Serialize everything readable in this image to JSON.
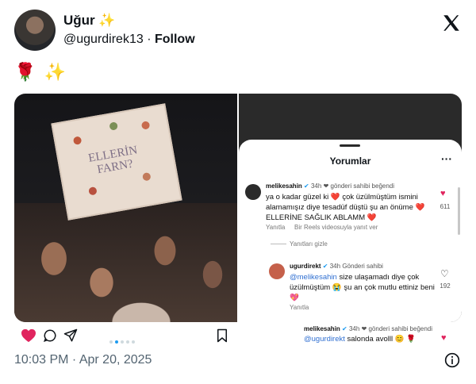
{
  "author": {
    "name": "Uğur",
    "name_emoji": "✨",
    "handle": "@ugurdirek13",
    "separator": "·",
    "follow_label": "Follow"
  },
  "tweet_text": "🌹 ✨",
  "sign_text": "ELLERİN FARN?",
  "comments": {
    "title": "Yorumlar",
    "more": "···",
    "items": [
      {
        "user": "melikesahin",
        "time": "34h",
        "badge": "❤ gönderi sahibi beğendi",
        "text": "ya o kadar güzel ki ❤️ çok üzülmüştüm ismini alamamışız diye tesadüf düştü şu an önüme ❤️ ELLERİNE SAĞLIK ABLAMM ❤️",
        "reply": "Yanıtla",
        "extra": "Bir Reels videosuyla yanıt ver",
        "likes": "611",
        "hide_replies": "Yanıtları gizle"
      },
      {
        "user": "ugurdirekt",
        "time": "34h",
        "badge": "Gönderi sahibi",
        "mention": "@melikesahin",
        "text": " size ulaşamadı diye çok üzülmüştüm 😭 şu an çok mutlu ettiniz beni 💖",
        "reply": "Yanıtla",
        "likes": "192"
      },
      {
        "user": "melikesahin",
        "time": "34h",
        "badge": "❤ gönderi sahibi beğendi",
        "mention": "@ugurdirekt",
        "text": " salonda avolll 😊 🌹"
      }
    ]
  },
  "actions": {
    "like_icon": "heart-icon",
    "comment_icon": "comment-icon",
    "share_icon": "send-icon",
    "save_icon": "bookmark-icon"
  },
  "timestamp": "10:03 PM · Apr 20, 2025",
  "colors": {
    "like_red": "#e0245e",
    "link_blue": "#2f6fd1",
    "timestamp_gray": "#536471"
  }
}
